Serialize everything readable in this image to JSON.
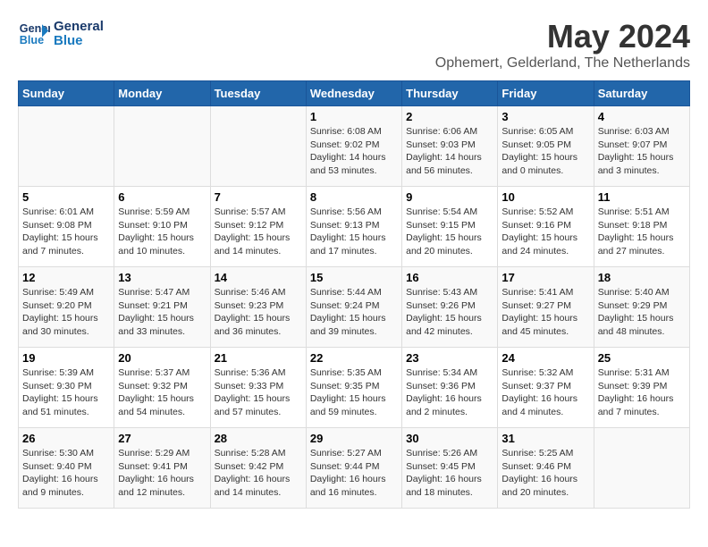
{
  "logo": {
    "line1": "General",
    "line2": "Blue"
  },
  "title": "May 2024",
  "subtitle": "Ophemert, Gelderland, The Netherlands",
  "weekdays": [
    "Sunday",
    "Monday",
    "Tuesday",
    "Wednesday",
    "Thursday",
    "Friday",
    "Saturday"
  ],
  "weeks": [
    [
      {
        "day": "",
        "info": ""
      },
      {
        "day": "",
        "info": ""
      },
      {
        "day": "",
        "info": ""
      },
      {
        "day": "1",
        "info": "Sunrise: 6:08 AM\nSunset: 9:02 PM\nDaylight: 14 hours and 53 minutes."
      },
      {
        "day": "2",
        "info": "Sunrise: 6:06 AM\nSunset: 9:03 PM\nDaylight: 14 hours and 56 minutes."
      },
      {
        "day": "3",
        "info": "Sunrise: 6:05 AM\nSunset: 9:05 PM\nDaylight: 15 hours and 0 minutes."
      },
      {
        "day": "4",
        "info": "Sunrise: 6:03 AM\nSunset: 9:07 PM\nDaylight: 15 hours and 3 minutes."
      }
    ],
    [
      {
        "day": "5",
        "info": "Sunrise: 6:01 AM\nSunset: 9:08 PM\nDaylight: 15 hours and 7 minutes."
      },
      {
        "day": "6",
        "info": "Sunrise: 5:59 AM\nSunset: 9:10 PM\nDaylight: 15 hours and 10 minutes."
      },
      {
        "day": "7",
        "info": "Sunrise: 5:57 AM\nSunset: 9:12 PM\nDaylight: 15 hours and 14 minutes."
      },
      {
        "day": "8",
        "info": "Sunrise: 5:56 AM\nSunset: 9:13 PM\nDaylight: 15 hours and 17 minutes."
      },
      {
        "day": "9",
        "info": "Sunrise: 5:54 AM\nSunset: 9:15 PM\nDaylight: 15 hours and 20 minutes."
      },
      {
        "day": "10",
        "info": "Sunrise: 5:52 AM\nSunset: 9:16 PM\nDaylight: 15 hours and 24 minutes."
      },
      {
        "day": "11",
        "info": "Sunrise: 5:51 AM\nSunset: 9:18 PM\nDaylight: 15 hours and 27 minutes."
      }
    ],
    [
      {
        "day": "12",
        "info": "Sunrise: 5:49 AM\nSunset: 9:20 PM\nDaylight: 15 hours and 30 minutes."
      },
      {
        "day": "13",
        "info": "Sunrise: 5:47 AM\nSunset: 9:21 PM\nDaylight: 15 hours and 33 minutes."
      },
      {
        "day": "14",
        "info": "Sunrise: 5:46 AM\nSunset: 9:23 PM\nDaylight: 15 hours and 36 minutes."
      },
      {
        "day": "15",
        "info": "Sunrise: 5:44 AM\nSunset: 9:24 PM\nDaylight: 15 hours and 39 minutes."
      },
      {
        "day": "16",
        "info": "Sunrise: 5:43 AM\nSunset: 9:26 PM\nDaylight: 15 hours and 42 minutes."
      },
      {
        "day": "17",
        "info": "Sunrise: 5:41 AM\nSunset: 9:27 PM\nDaylight: 15 hours and 45 minutes."
      },
      {
        "day": "18",
        "info": "Sunrise: 5:40 AM\nSunset: 9:29 PM\nDaylight: 15 hours and 48 minutes."
      }
    ],
    [
      {
        "day": "19",
        "info": "Sunrise: 5:39 AM\nSunset: 9:30 PM\nDaylight: 15 hours and 51 minutes."
      },
      {
        "day": "20",
        "info": "Sunrise: 5:37 AM\nSunset: 9:32 PM\nDaylight: 15 hours and 54 minutes."
      },
      {
        "day": "21",
        "info": "Sunrise: 5:36 AM\nSunset: 9:33 PM\nDaylight: 15 hours and 57 minutes."
      },
      {
        "day": "22",
        "info": "Sunrise: 5:35 AM\nSunset: 9:35 PM\nDaylight: 15 hours and 59 minutes."
      },
      {
        "day": "23",
        "info": "Sunrise: 5:34 AM\nSunset: 9:36 PM\nDaylight: 16 hours and 2 minutes."
      },
      {
        "day": "24",
        "info": "Sunrise: 5:32 AM\nSunset: 9:37 PM\nDaylight: 16 hours and 4 minutes."
      },
      {
        "day": "25",
        "info": "Sunrise: 5:31 AM\nSunset: 9:39 PM\nDaylight: 16 hours and 7 minutes."
      }
    ],
    [
      {
        "day": "26",
        "info": "Sunrise: 5:30 AM\nSunset: 9:40 PM\nDaylight: 16 hours and 9 minutes."
      },
      {
        "day": "27",
        "info": "Sunrise: 5:29 AM\nSunset: 9:41 PM\nDaylight: 16 hours and 12 minutes."
      },
      {
        "day": "28",
        "info": "Sunrise: 5:28 AM\nSunset: 9:42 PM\nDaylight: 16 hours and 14 minutes."
      },
      {
        "day": "29",
        "info": "Sunrise: 5:27 AM\nSunset: 9:44 PM\nDaylight: 16 hours and 16 minutes."
      },
      {
        "day": "30",
        "info": "Sunrise: 5:26 AM\nSunset: 9:45 PM\nDaylight: 16 hours and 18 minutes."
      },
      {
        "day": "31",
        "info": "Sunrise: 5:25 AM\nSunset: 9:46 PM\nDaylight: 16 hours and 20 minutes."
      },
      {
        "day": "",
        "info": ""
      }
    ]
  ]
}
